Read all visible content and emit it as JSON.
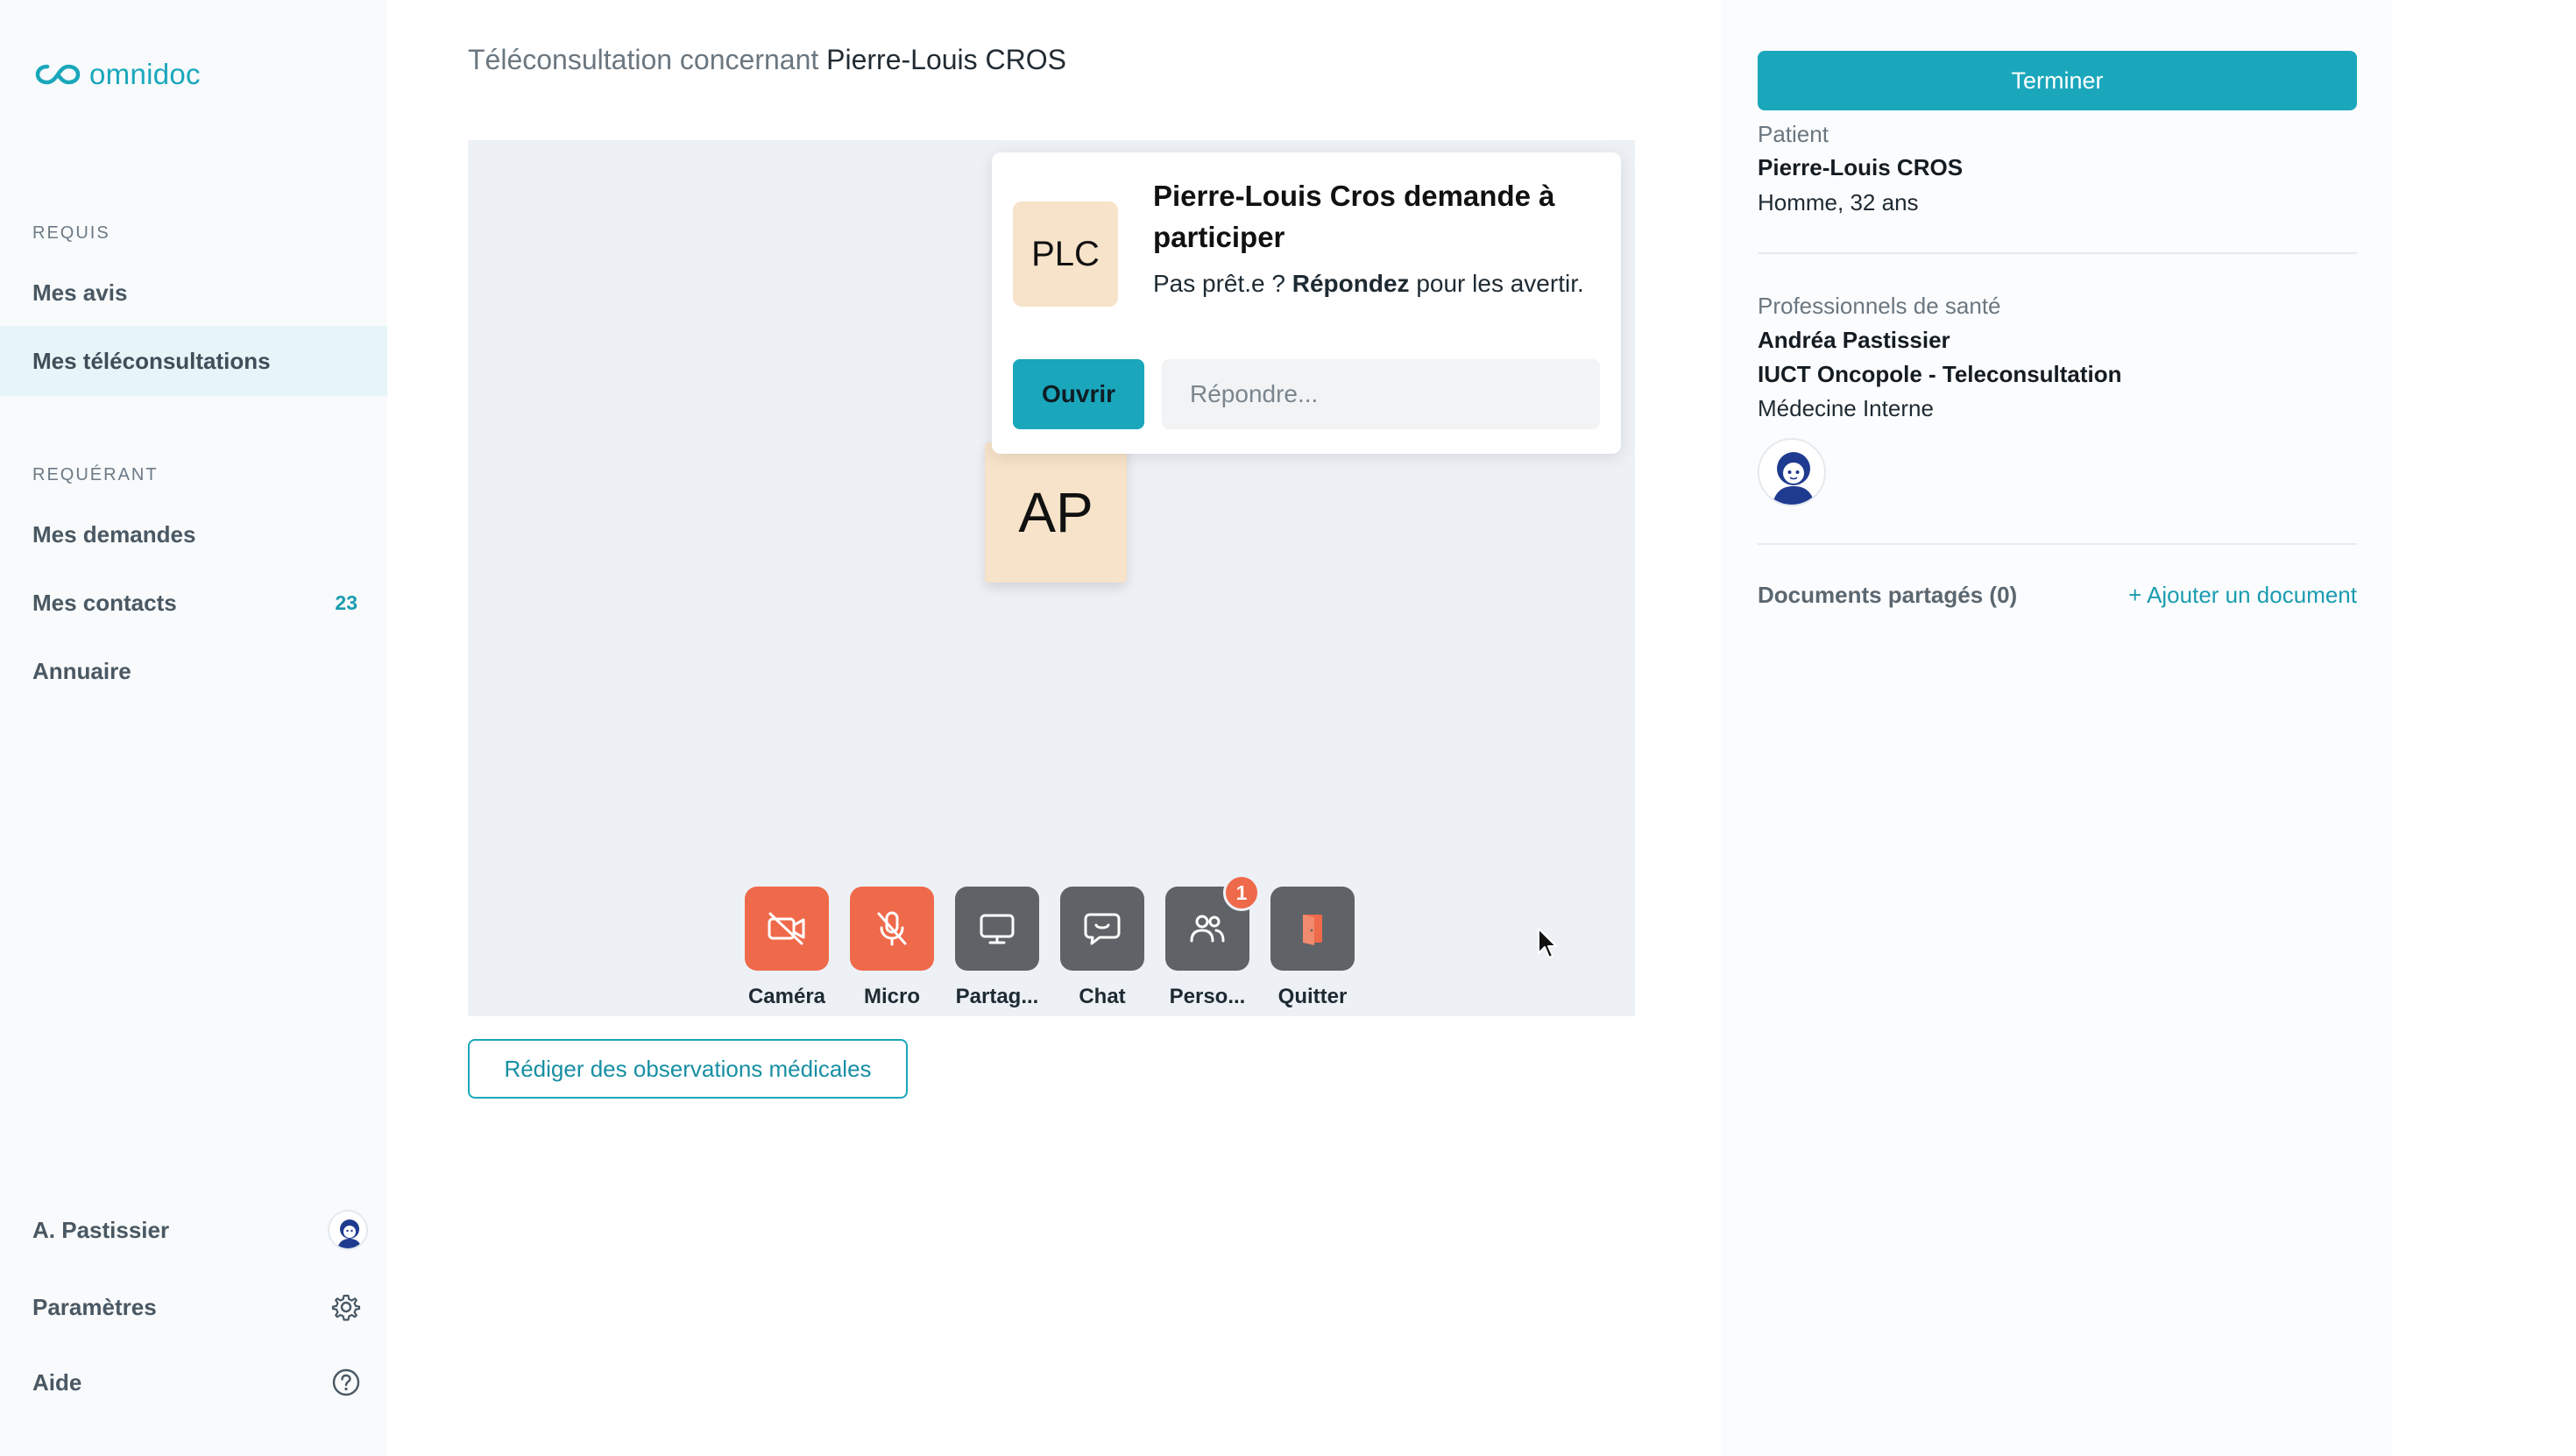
{
  "sidebar": {
    "logo_text": "omnidoc",
    "sections": [
      {
        "title": "REQUIS",
        "items": [
          {
            "label": "Mes avis",
            "active": false
          },
          {
            "label": "Mes téléconsultations",
            "active": true
          }
        ]
      },
      {
        "title": "REQUÉRANT",
        "items": [
          {
            "label": "Mes demandes",
            "active": false
          },
          {
            "label": "Mes contacts",
            "count": "23",
            "active": false
          },
          {
            "label": "Annuaire",
            "active": false
          }
        ]
      }
    ],
    "footer": {
      "user_label": "A. Pastissier",
      "settings_label": "Paramètres",
      "help_label": "Aide"
    }
  },
  "main": {
    "title_prefix": "Téléconsultation concernant",
    "title_patient": "Pierre-Louis CROS",
    "participant_tile": "AP",
    "notification": {
      "avatar_initials": "PLC",
      "title": "Pierre-Louis Cros demande à participer",
      "text_before": "Pas prêt.e ? ",
      "text_bold": "Répondez",
      "text_after": " pour les avertir.",
      "open_label": "Ouvrir",
      "reply_placeholder": "Répondre..."
    },
    "controls": [
      {
        "label": "Caméra",
        "icon": "camera-off-icon",
        "state": "off"
      },
      {
        "label": "Micro",
        "icon": "mic-off-icon",
        "state": "off"
      },
      {
        "label": "Partag...",
        "icon": "screen-share-icon"
      },
      {
        "label": "Chat",
        "icon": "chat-icon"
      },
      {
        "label": "Perso...",
        "icon": "people-icon",
        "badge": "1"
      },
      {
        "label": "Quitter",
        "icon": "exit-door-icon"
      }
    ],
    "observations_label": "Rédiger des observations médicales"
  },
  "right": {
    "terminate_label": "Terminer",
    "patient_label": "Patient",
    "patient_name": "Pierre-Louis CROS",
    "patient_info": "Homme, 32 ans",
    "pros_label": "Professionnels de santé",
    "pro_name": "Andréa Pastissier",
    "pro_org": "IUCT Oncopole - Teleconsultation",
    "pro_specialty": "Médecine Interne",
    "docs_label": "Documents partagés (0)",
    "add_doc_label": "Ajouter un document"
  },
  "colors": {
    "accent": "#1aa7bc",
    "danger": "#ef6a4a",
    "control_gray": "#5f6367",
    "avatar_bg": "#f7e3c9",
    "video_bg": "#edf1f6"
  }
}
